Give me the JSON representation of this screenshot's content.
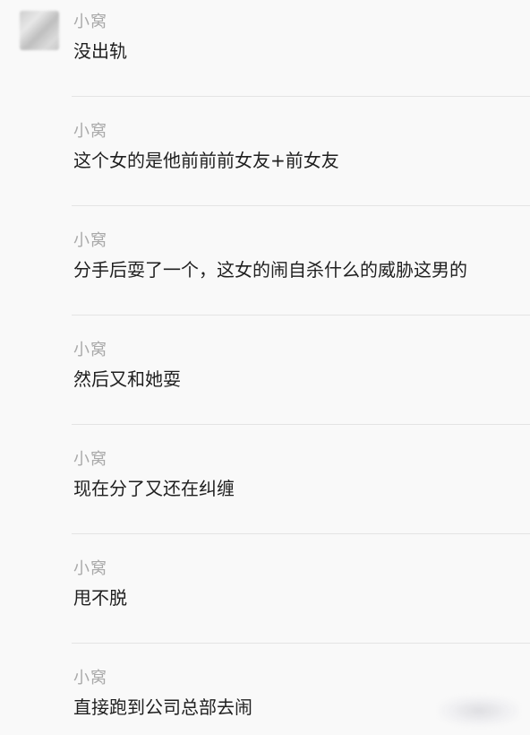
{
  "chat": {
    "messages": [
      {
        "sender": "小窝",
        "text": "没出轨"
      },
      {
        "sender": "小窝",
        "text": "这个女的是他前前前女友+前女友"
      },
      {
        "sender": "小窝",
        "text": "分手后耍了一个，这女的闹自杀什么的威胁这男的"
      },
      {
        "sender": "小窝",
        "text": "然后又和她耍"
      },
      {
        "sender": "小窝",
        "text": "现在分了又还在纠缠"
      },
      {
        "sender": "小窝",
        "text": "甩不脱"
      },
      {
        "sender": "小窝",
        "text": "直接跑到公司总部去闹"
      }
    ]
  }
}
